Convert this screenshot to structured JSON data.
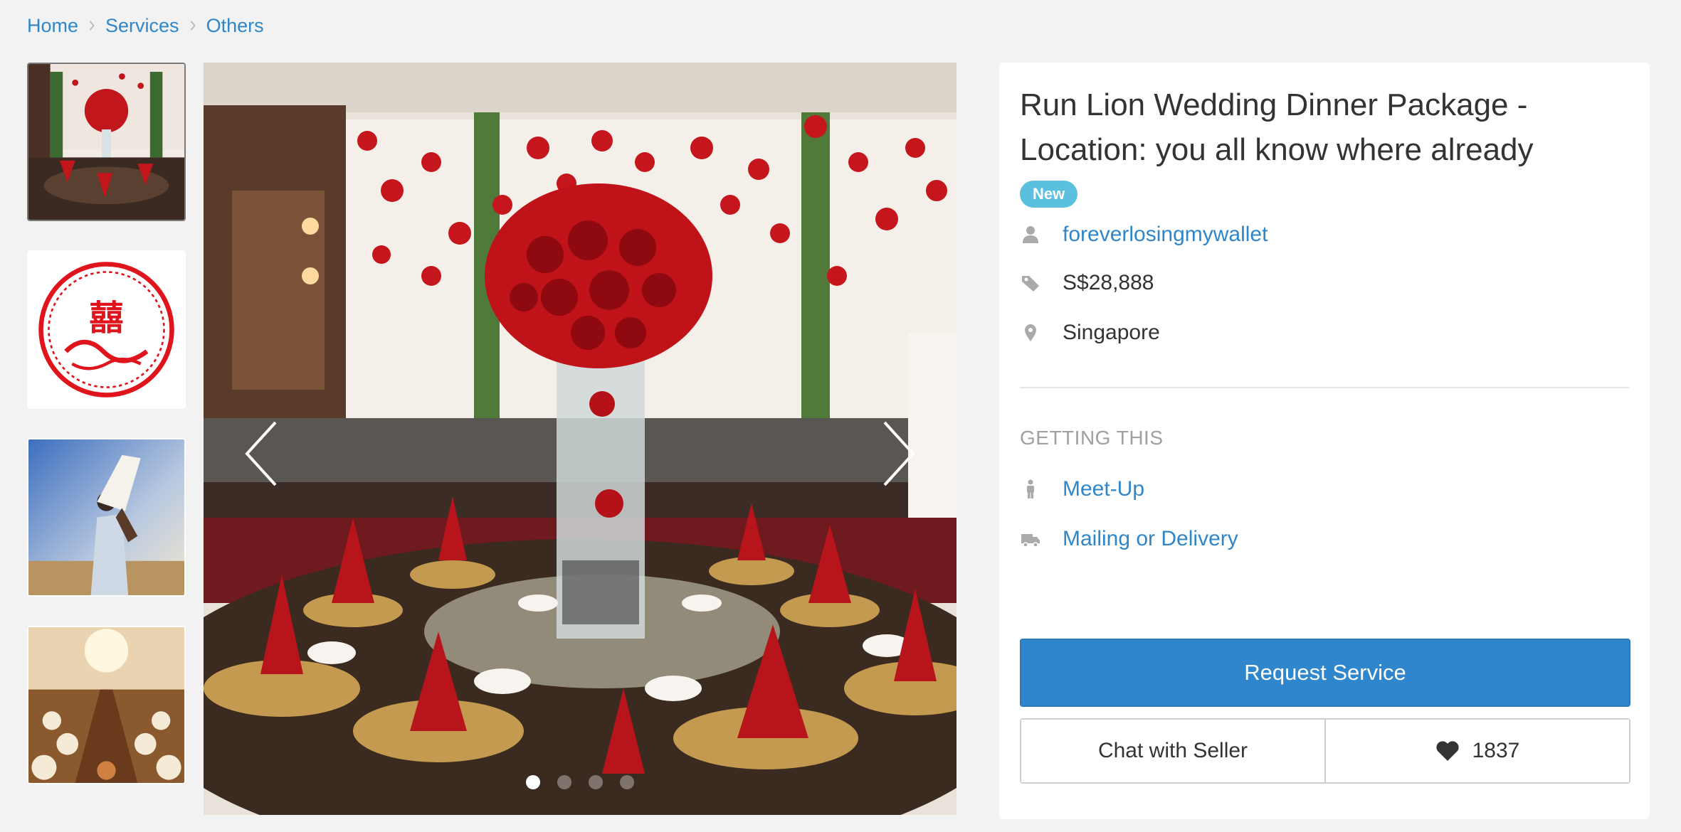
{
  "breadcrumb": [
    {
      "label": "Home"
    },
    {
      "label": "Services"
    },
    {
      "label": "Others"
    }
  ],
  "gallery": {
    "thumbnails": [
      {
        "icon": "wedding-banquet-thumb"
      },
      {
        "icon": "double-happiness-papercut-thumb"
      },
      {
        "icon": "couple-embrace-thumb"
      },
      {
        "icon": "banquet-hall-thumb"
      }
    ],
    "active_thumbnail": 1,
    "slide_count": 4,
    "active_slide": 1,
    "prev_icon": "chevron-left-icon",
    "next_icon": "chevron-right-icon"
  },
  "listing": {
    "title": "Run Lion Wedding Dinner Package - Location: you all know where already",
    "badge": "New",
    "seller": "foreverlosingmywallet",
    "price": "S$28,888",
    "location": "Singapore"
  },
  "delivery": {
    "section_label": "GETTING THIS",
    "options": [
      {
        "label": "Meet-Up",
        "icon": "person-icon"
      },
      {
        "label": "Mailing or Delivery",
        "icon": "truck-icon"
      }
    ]
  },
  "actions": {
    "request_label": "Request Service",
    "chat_label": "Chat with Seller",
    "like_count": "1837"
  },
  "colors": {
    "link": "#2f86c8",
    "primary_button": "#2f86cc",
    "badge": "#5bc0de",
    "background": "#f2f2f2"
  }
}
